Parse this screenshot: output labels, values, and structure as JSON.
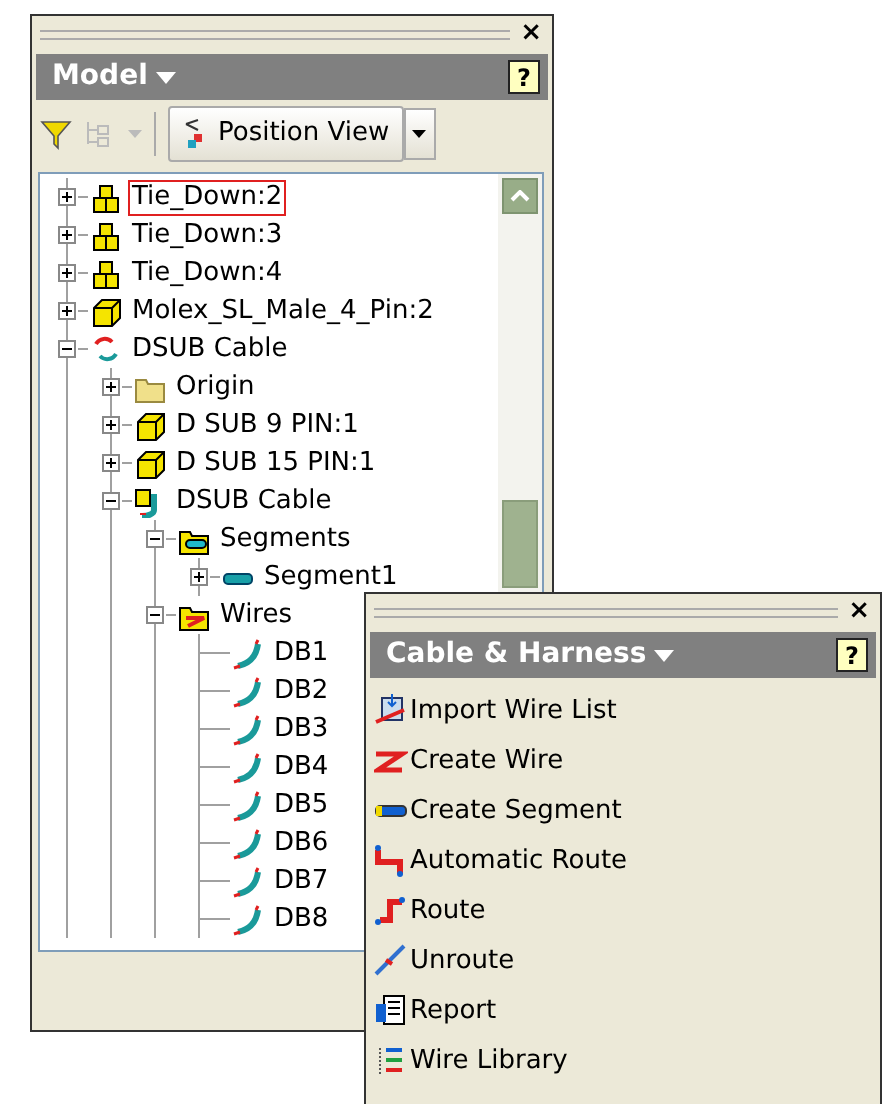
{
  "model_panel": {
    "close": "×",
    "title": "Model",
    "help": "?",
    "toolbar": {
      "tree_options": {
        "disabled": true
      },
      "position_view": {
        "label": "Position View"
      }
    },
    "tree": [
      {
        "label": "Tie_Down:2",
        "kind": "assembly",
        "selected": true,
        "expanded": false
      },
      {
        "label": "Tie_Down:3",
        "kind": "assembly",
        "selected": false,
        "expanded": false
      },
      {
        "label": "Tie_Down:4",
        "kind": "assembly",
        "selected": false,
        "expanded": false
      },
      {
        "label": "Molex_SL_Male_4_Pin:2",
        "kind": "part",
        "selected": false,
        "expanded": false
      },
      {
        "label": "DSUB Cable",
        "kind": "harness-root",
        "selected": false,
        "expanded": true,
        "children": [
          {
            "label": "Origin",
            "kind": "folder",
            "selected": false,
            "expanded": false
          },
          {
            "label": "D SUB 9 PIN:1",
            "kind": "part",
            "selected": false,
            "expanded": false
          },
          {
            "label": "D SUB 15 PIN:1",
            "kind": "part",
            "selected": false,
            "expanded": false
          },
          {
            "label": "DSUB Cable",
            "kind": "harness",
            "selected": false,
            "expanded": true,
            "children": [
              {
                "label": "Segments",
                "kind": "segments",
                "selected": false,
                "expanded": true,
                "children": [
                  {
                    "label": "Segment1",
                    "kind": "segment",
                    "selected": false,
                    "expanded": false
                  }
                ]
              },
              {
                "label": "Wires",
                "kind": "wires",
                "selected": false,
                "expanded": true,
                "children": [
                  {
                    "label": "DB1",
                    "kind": "wire",
                    "selected": false
                  },
                  {
                    "label": "DB2",
                    "kind": "wire",
                    "selected": false
                  },
                  {
                    "label": "DB3",
                    "kind": "wire",
                    "selected": false
                  },
                  {
                    "label": "DB4",
                    "kind": "wire",
                    "selected": false
                  },
                  {
                    "label": "DB5",
                    "kind": "wire",
                    "selected": false
                  },
                  {
                    "label": "DB6",
                    "kind": "wire",
                    "selected": false
                  },
                  {
                    "label": "DB7",
                    "kind": "wire",
                    "selected": false
                  },
                  {
                    "label": "DB8",
                    "kind": "wire",
                    "selected": false
                  }
                ]
              }
            ]
          }
        ]
      }
    ]
  },
  "cable_panel": {
    "close": "×",
    "title": "Cable & Harness",
    "help": "?",
    "commands": [
      {
        "label": "Import Wire List",
        "kind": "import"
      },
      {
        "label": "Create Wire",
        "kind": "wire"
      },
      {
        "label": "Create Segment",
        "kind": "segment"
      },
      {
        "label": "Automatic Route",
        "kind": "autoroute"
      },
      {
        "label": "Route",
        "kind": "route"
      },
      {
        "label": "Unroute",
        "kind": "unroute"
      },
      {
        "label": "Report",
        "kind": "report"
      },
      {
        "label": "Wire Library",
        "kind": "library"
      }
    ]
  }
}
